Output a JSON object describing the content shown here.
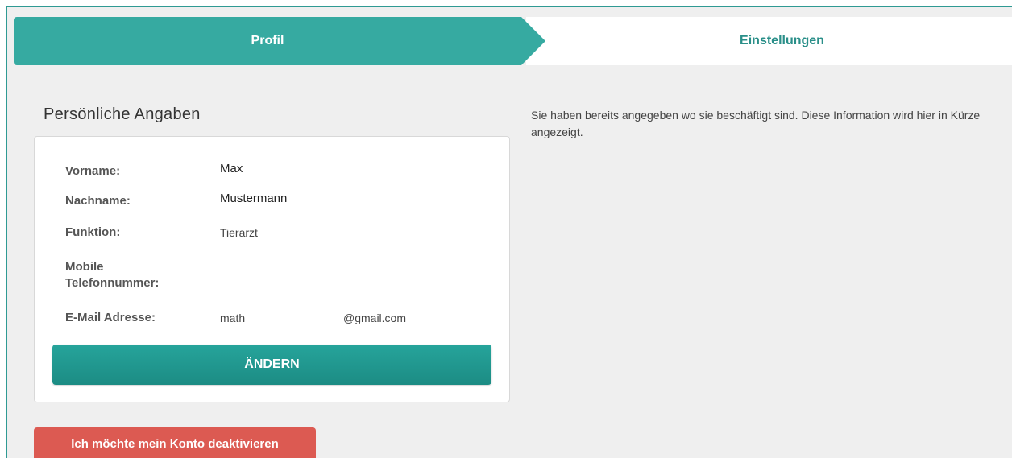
{
  "tabs": {
    "profile": "Profil",
    "settings": "Einstellungen"
  },
  "section": {
    "title": "Persönliche Angaben"
  },
  "profile": {
    "first_name_label": "Vorname:",
    "first_name_value": "Max",
    "last_name_label": "Nachname:",
    "last_name_value": "Mustermann",
    "function_label": "Funktion:",
    "function_value": "Tierarzt",
    "mobile_label_line1": "Mobile",
    "mobile_label_line2": "Telefonnummer:",
    "mobile_value": "",
    "email_label": "E-Mail Adresse:",
    "email_local": "math",
    "email_domain": "@gmail.com"
  },
  "buttons": {
    "change": "ÄNDERN",
    "deactivate": "Ich möchte mein Konto deaktivieren"
  },
  "info": {
    "employment_notice": "Sie haben bereits angegeben wo sie beschäftigt sind. Diese Information wird hier in Kürze angezeigt."
  },
  "colors": {
    "accent": "#36aaa1",
    "accent_dark": "#1c8c84",
    "danger": "#dc5a52",
    "background": "#efefef"
  }
}
